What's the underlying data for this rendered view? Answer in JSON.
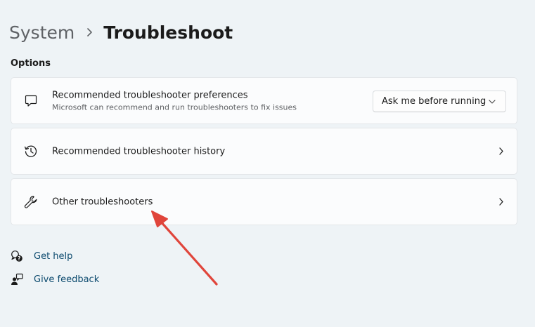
{
  "breadcrumb": {
    "parent": "System",
    "current": "Troubleshoot"
  },
  "section": {
    "options_label": "Options"
  },
  "cards": [
    {
      "icon": "chat-bubble-icon",
      "title": "Recommended troubleshooter preferences",
      "description": "Microsoft can recommend and run troubleshooters to fix issues",
      "dropdown_value": "Ask me before running"
    },
    {
      "icon": "history-icon",
      "title": "Recommended troubleshooter history"
    },
    {
      "icon": "wrench-icon",
      "title": "Other troubleshooters"
    }
  ],
  "links": {
    "get_help": "Get help",
    "give_feedback": "Give feedback"
  },
  "colors": {
    "background": "#eef3f6",
    "card": "#fbfcfd",
    "link": "#0c4a6e",
    "annotation_arrow": "#e0453b"
  }
}
